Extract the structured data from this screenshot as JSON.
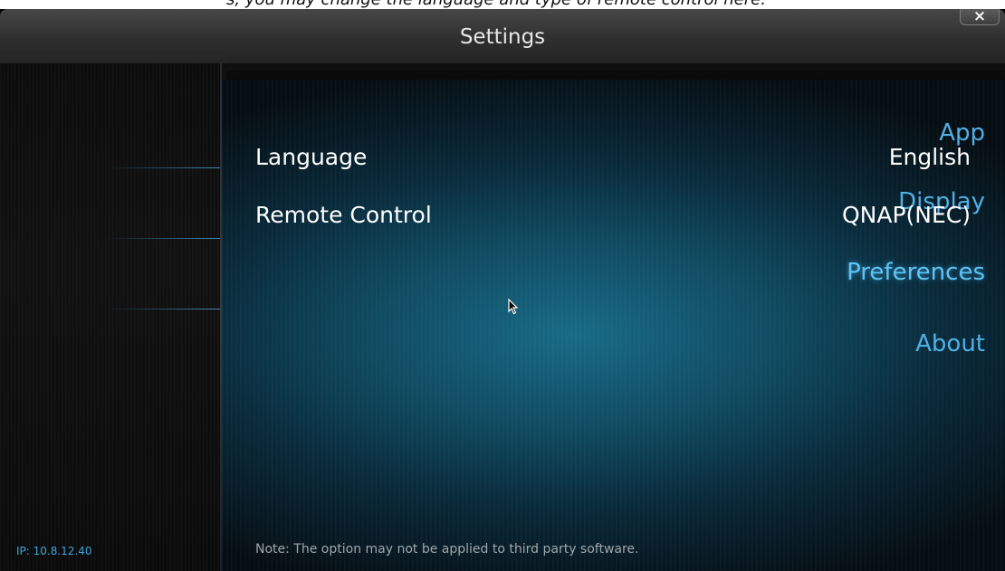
{
  "top_partial_text": "s, you may change the language and type of remote control here.",
  "window": {
    "title": "Settings",
    "close_label": "×"
  },
  "sidebar": {
    "items": [
      {
        "label": "App",
        "selected": false
      },
      {
        "label": "Display",
        "selected": false
      },
      {
        "label": "Preferences",
        "selected": true
      },
      {
        "label": "About",
        "selected": false
      }
    ],
    "ip_text": "IP: 10.8.12.40"
  },
  "settings": [
    {
      "label": "Language",
      "value": "English"
    },
    {
      "label": "Remote Control",
      "value": "QNAP(NEC)"
    }
  ],
  "note": "Note: The option may not be applied to third party software.",
  "colors": {
    "accent": "#4fb0e6",
    "selected": "#5cc4f5",
    "window_bg": "#060606",
    "content_bg": "#176a86"
  },
  "icons": {
    "close": "close-icon",
    "cursor": "mouse-pointer-icon"
  }
}
